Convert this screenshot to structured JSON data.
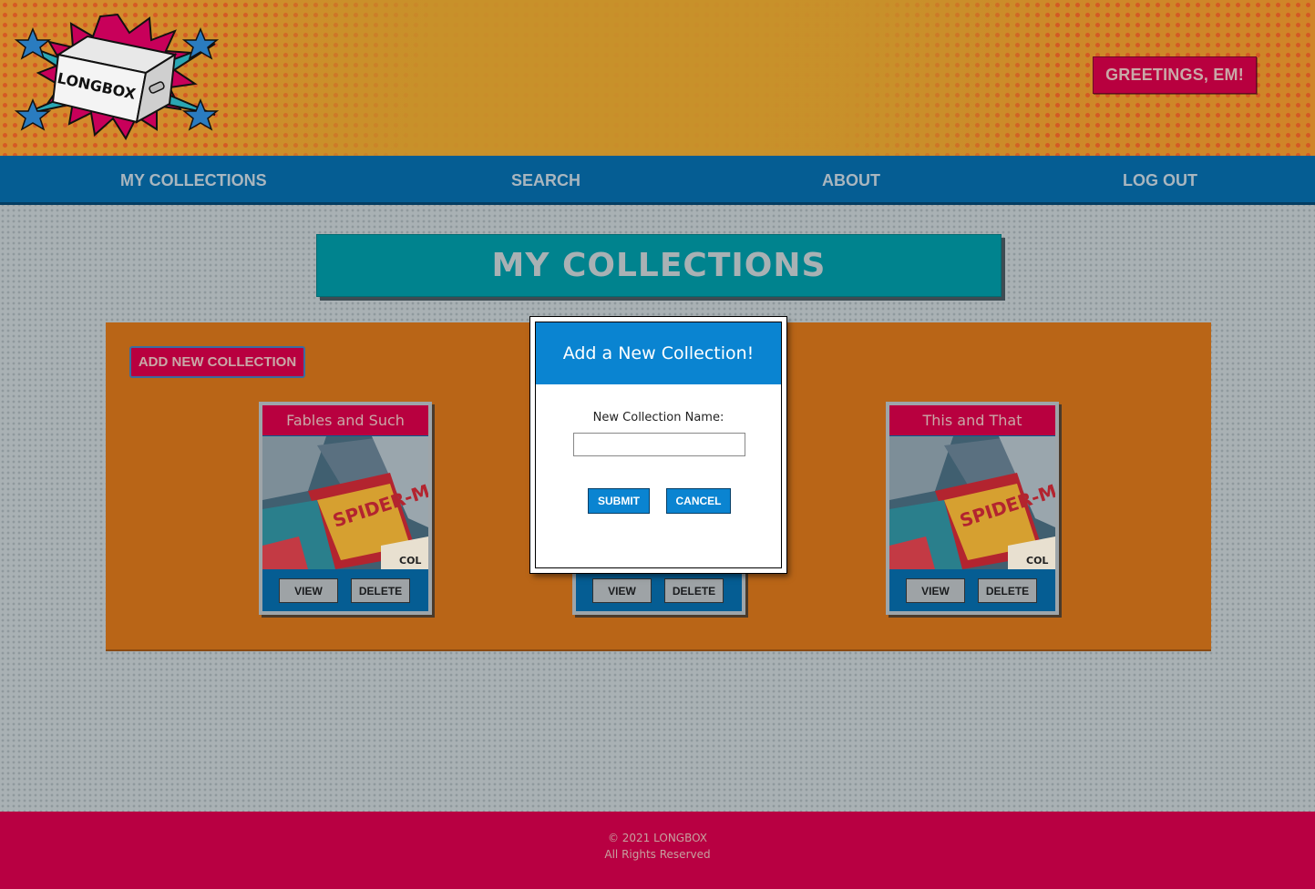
{
  "header": {
    "logo_text": "LONGBOX",
    "greeting": "GREETINGS, EM!"
  },
  "nav": {
    "items": [
      "MY COLLECTIONS",
      "SEARCH",
      "ABOUT",
      "LOG OUT"
    ]
  },
  "page": {
    "title": "MY COLLECTIONS",
    "add_button": "ADD NEW COLLECTION"
  },
  "collections": [
    {
      "name": "Fables and Such",
      "view": "VIEW",
      "delete": "DELETE"
    },
    {
      "name": "",
      "view": "VIEW",
      "delete": "DELETE"
    },
    {
      "name": "This and That",
      "view": "VIEW",
      "delete": "DELETE"
    }
  ],
  "modal": {
    "title": "Add a New Collection!",
    "label": "New Collection Name:",
    "input_value": "",
    "submit": "SUBMIT",
    "cancel": "CANCEL"
  },
  "footer": {
    "copyright": "© 2021 LONGBOX",
    "rights": "All Rights Reserved"
  },
  "colors": {
    "primary_pink": "#b8003f",
    "nav_blue": "#055d93",
    "teal": "#00838e",
    "panel_orange": "#b96517",
    "modal_blue": "#0a84d1"
  }
}
